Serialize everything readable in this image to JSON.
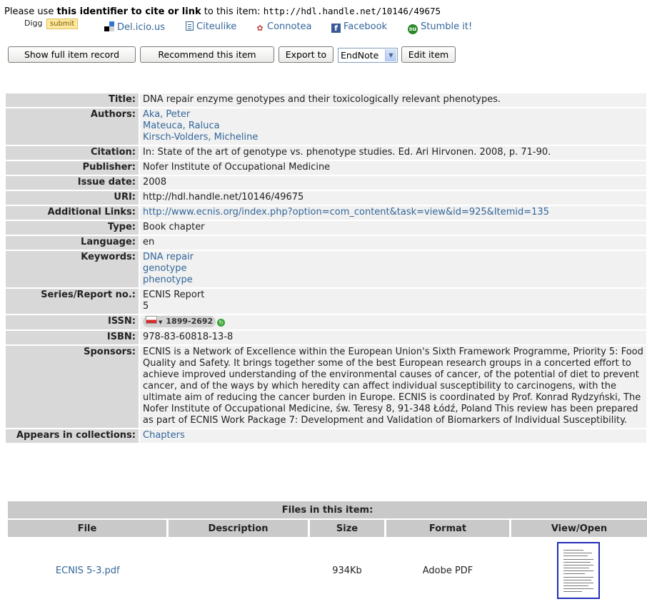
{
  "cite": {
    "prefix": "Please use ",
    "bold": "this identifier to cite or link",
    "middle": " to this item: ",
    "handle": "http://hdl.handle.net/10146/49675"
  },
  "social": {
    "digg_label": "Digg",
    "digg_submit": "submit",
    "delicious": "Del.icio.us",
    "citeulike": "Citeulike",
    "connotea": "Connotea",
    "facebook": "Facebook",
    "stumble": "Stumble it!"
  },
  "actions": {
    "show_full": "Show full item record",
    "recommend": "Recommend this item",
    "export": "Export to",
    "export_format": "EndNote",
    "edit": "Edit item"
  },
  "metadata": {
    "title_label": "Title:",
    "title": "DNA repair enzyme genotypes and their toxicologically relevant phenotypes.",
    "authors_label": "Authors:",
    "authors": [
      "Aka, Peter",
      "Mateuca, Raluca",
      "Kirsch-Volders, Micheline"
    ],
    "citation_label": "Citation:",
    "citation": "In: State of the art of genotype vs. phenotype studies. Ed. Ari Hirvonen. 2008, p. 71-90.",
    "publisher_label": "Publisher:",
    "publisher": "Nofer Institute of Occupational Medicine",
    "issue_date_label": "Issue date:",
    "issue_date": "2008",
    "uri_label": "URI:",
    "uri": "http://hdl.handle.net/10146/49675",
    "links_label": "Additional Links:",
    "link": "http://www.ecnis.org/index.php?option=com_content&task=view&id=925&Itemid=135",
    "type_label": "Type:",
    "type": "Book chapter",
    "language_label": "Language:",
    "language": "en",
    "keywords_label": "Keywords:",
    "keywords": [
      "DNA repair",
      "genotype",
      "phenotype"
    ],
    "series_label": "Series/Report no.:",
    "series": [
      "ECNIS Report",
      "5"
    ],
    "issn_label": "ISSN:",
    "issn": "1899-2692",
    "isbn_label": "ISBN:",
    "isbn": "978-83-60818-13-8",
    "sponsors_label": "Sponsors:",
    "sponsors": "ECNIS is a Network of Excellence within the European Union's Sixth Framework Programme, Priority 5: Food Quality and Safety. It brings together some of the best European research groups in a concerted effort to achieve improved understanding of the environmental causes of cancer, of the potential of diet to prevent cancer, and of the ways by which heredity can affect individual susceptibility to carcinogens, with the ultimate aim of reducing the cancer burden in Europe. ECNIS is coordinated by Prof. Konrad Rydzyński, The Nofer Institute of Occupational Medicine, św. Teresy 8, 91-348 Łódź, Poland This review has been prepared as part of ECNIS Work Package 7: Development and Validation of Biomarkers of Individual Susceptibility.",
    "collections_label": "Appears in collections:",
    "collection": "Chapters"
  },
  "files": {
    "caption": "Files in this item:",
    "headers": [
      "File",
      "Description",
      "Size",
      "Format",
      "View/Open"
    ],
    "rows": [
      {
        "file": "ECNIS 5-3.pdf",
        "description": "",
        "size": "934Kb",
        "format": "Adobe PDF"
      }
    ]
  },
  "colors": {
    "link": "#336699",
    "label_bg": "#d8d8d8",
    "value_bg": "#f1f1f1",
    "header_bg": "#c9c9c9"
  }
}
